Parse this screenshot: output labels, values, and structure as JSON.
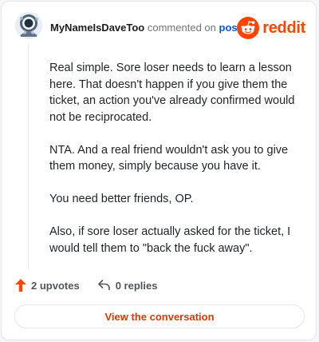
{
  "header": {
    "username": "MyNameIsDaveToo",
    "commented_text": "commented on",
    "post_link": "post",
    "brand_name": "reddit",
    "brand_color": "#ff4500",
    "link_color": "#0d5bc5"
  },
  "comment": {
    "paragraphs": [
      "Real simple. Sore loser needs to learn a lesson here. That doesn't happen if you give them the ticket, an action you've already confirmed would not be reciprocated.",
      "NTA. And a real friend wouldn't ask you to give them money, simply because you have it.",
      "You need better friends, OP.",
      "Also, if sore loser actually asked for the ticket, I would tell them to \"back the fuck away\"."
    ]
  },
  "footer": {
    "upvotes": "2 upvotes",
    "replies": "0 replies",
    "upvote_color": "#ff4500"
  },
  "cta": {
    "label": "View the conversation",
    "color": "#d93a00"
  }
}
